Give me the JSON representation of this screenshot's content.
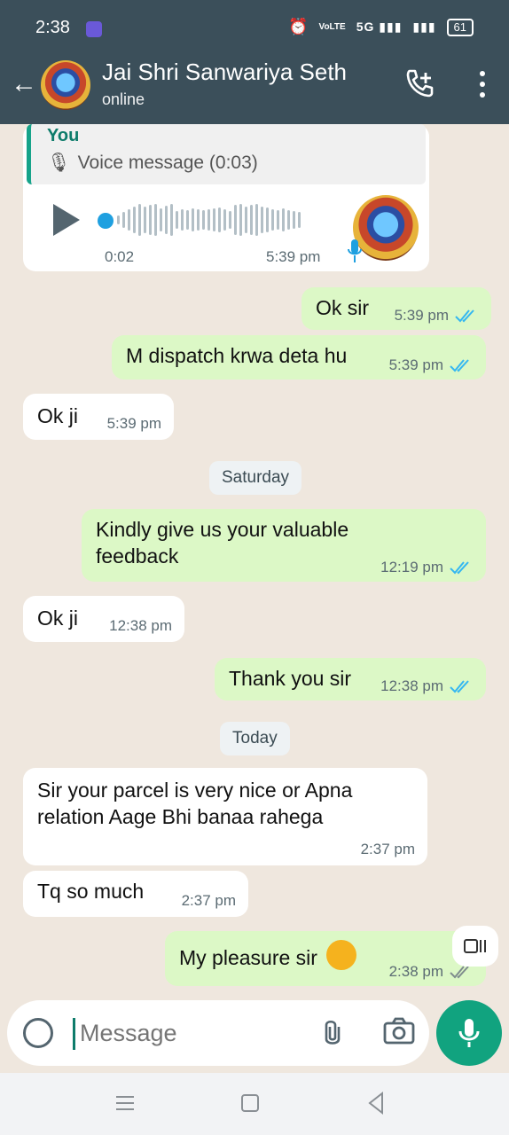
{
  "status_bar": {
    "time": "2:38",
    "volte": "VoLTE",
    "network": "5G",
    "battery": "61"
  },
  "header": {
    "contact_name": "Jai Shri Sanwariya Seth",
    "status": "online"
  },
  "quote": {
    "author": "You",
    "text": "Voice message (0:03)"
  },
  "voice_message": {
    "elapsed": "0:02",
    "time": "5:39 pm"
  },
  "messages": [
    {
      "text": "Ok sir",
      "time": "5:39 pm",
      "direction": "out"
    },
    {
      "text": "M dispatch krwa deta hu",
      "time": "5:39 pm",
      "direction": "out"
    },
    {
      "text": "Ok ji",
      "time": "5:39 pm",
      "direction": "in"
    },
    {
      "text": "Kindly give us your valuable",
      "text2": "feedback",
      "time": "12:19 pm",
      "direction": "out"
    },
    {
      "text": "Ok ji",
      "time": "12:38 pm",
      "direction": "in"
    },
    {
      "text": "Thank you sir",
      "time": "12:38 pm",
      "direction": "out"
    },
    {
      "text": "Sir your parcel is very nice or Apna",
      "text2": "relation Aage Bhi banaa rahega",
      "time": "2:37 pm",
      "direction": "in"
    },
    {
      "text": "Tq so much",
      "time": "2:37 pm",
      "direction": "in"
    },
    {
      "text": "My pleasure sir",
      "time": "2:38 pm",
      "direction": "out"
    }
  ],
  "date_separators": {
    "saturday": "Saturday",
    "today": "Today"
  },
  "composer": {
    "placeholder": "Message"
  },
  "colors": {
    "header": "#3b4f5a",
    "outgoing_bubble": "#dcf8c6",
    "incoming_bubble": "#ffffff",
    "accent": "#11a37f",
    "read_tick": "#34b7f1"
  }
}
